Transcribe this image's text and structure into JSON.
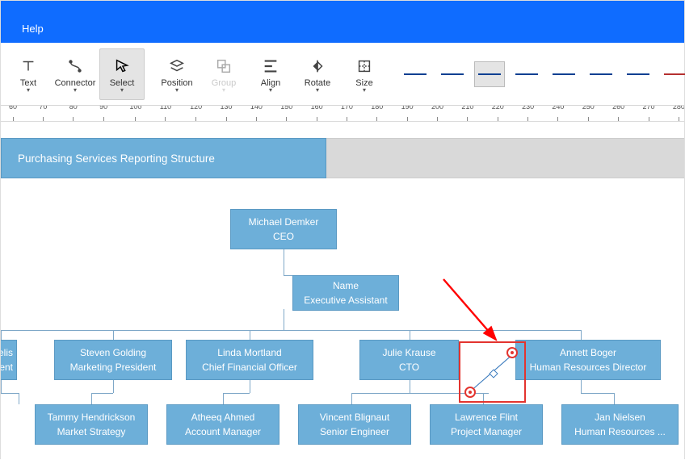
{
  "titlebar": {
    "menu_help": "Help"
  },
  "ribbon": {
    "text": "Text",
    "connector": "Connector",
    "select": "Select",
    "position": "Position",
    "group": "Group",
    "align": "Align",
    "rotate": "Rotate",
    "size": "Size",
    "swatches": [
      {
        "color": "#0b3f91",
        "style": "solid",
        "selected": false
      },
      {
        "color": "#0b3f91",
        "style": "solid",
        "selected": false
      },
      {
        "color": "#0b3f91",
        "style": "solid",
        "selected": true
      },
      {
        "color": "#0b3f91",
        "style": "solid",
        "selected": false
      },
      {
        "color": "#0b3f91",
        "style": "solid",
        "selected": false
      },
      {
        "color": "#0b3f91",
        "style": "solid",
        "selected": false
      },
      {
        "color": "#0b3f91",
        "style": "solid",
        "selected": false
      },
      {
        "color": "#b53030",
        "style": "solid",
        "selected": false
      }
    ]
  },
  "ruler": {
    "start": 60,
    "end": 280,
    "step": 10
  },
  "diagram": {
    "title": "Purchasing Services Reporting Structure",
    "ceo": {
      "name": "Michael Demker",
      "title": "CEO"
    },
    "ea": {
      "name": "Name",
      "title": "Executive Assistant"
    },
    "row1": [
      {
        "name": "elis",
        "title": "dent",
        "truncated": true
      },
      {
        "name": "Steven Golding",
        "title": "Marketing President"
      },
      {
        "name": "Linda Mortland",
        "title": "Chief Financial Officer"
      },
      {
        "name": "Julie Krause",
        "title": "CTO"
      },
      {
        "name": "Annett Boger",
        "title": "Human Resources Director"
      }
    ],
    "row2": [
      {
        "name": "Tammy Hendrickson",
        "title": "Market Strategy"
      },
      {
        "name": "Atheeq Ahmed",
        "title": "Account Manager"
      },
      {
        "name": "Vincent Blignaut",
        "title": "Senior Engineer"
      },
      {
        "name": "Lawrence Flint",
        "title": "Project Manager"
      },
      {
        "name": "Jan Nielsen",
        "title": "Human Resources ..."
      }
    ]
  },
  "colors": {
    "node": "#6dafd9",
    "brand": "#0f6cff",
    "sel": "#e3342f"
  }
}
